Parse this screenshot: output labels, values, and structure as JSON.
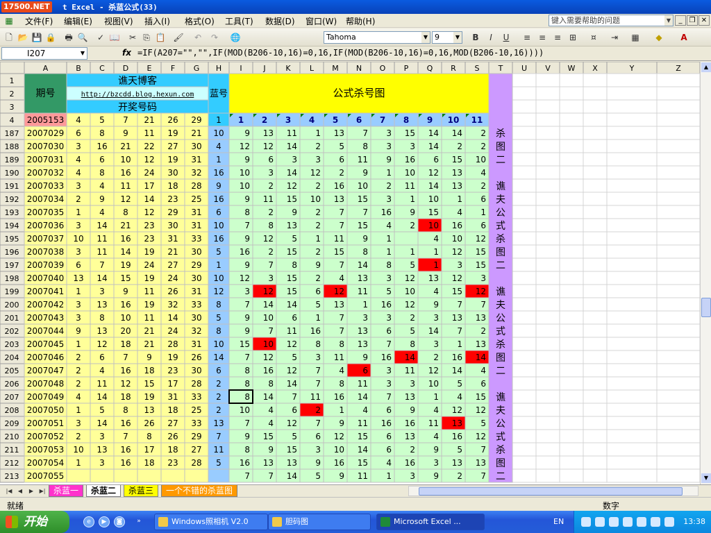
{
  "titlebar": {
    "logo": "17500.NET",
    "title": "t Excel - 杀蓝公式(33)"
  },
  "menu": {
    "items": [
      "文件(F)",
      "编辑(E)",
      "视图(V)",
      "插入(I)",
      "格式(O)",
      "工具(T)",
      "数据(D)",
      "窗口(W)",
      "帮助(H)"
    ],
    "help_placeholder": "键入需要帮助的问题"
  },
  "toolbar": {
    "font_name": "Tahoma",
    "font_size": "9",
    "bold": "B",
    "italic": "I",
    "underline": "U"
  },
  "formula_bar": {
    "name_box": "I207",
    "fx": "fx",
    "formula": "=IF(A207=\"\",\"\",IF(MOD(B206-10,16)=0,16,IF(MOD(B206-10,16)=0,16,MOD(B206-10,16))))"
  },
  "sheet": {
    "columns": [
      "A",
      "B",
      "C",
      "D",
      "E",
      "F",
      "G",
      "H",
      "I",
      "J",
      "K",
      "L",
      "M",
      "N",
      "O",
      "P",
      "Q",
      "R",
      "S",
      "T",
      "U",
      "V",
      "W",
      "X",
      "Y",
      "Z"
    ],
    "header": {
      "period_label": "期号",
      "blog_title": "谯天博客",
      "blog_url": "http://bzcdd.blog.hexun.com",
      "draw_label": "开奖号码",
      "blue_label": "蓝号",
      "chart_title": "公式杀号图",
      "row4_period": "2005153",
      "row4_numbers": [
        "4",
        "5",
        "7",
        "21",
        "26",
        "29"
      ],
      "row4_blue": "1",
      "formula_numbers": [
        "1",
        "2",
        "3",
        "4",
        "5",
        "6",
        "7",
        "8",
        "9",
        "10",
        "11"
      ]
    },
    "row_numbers": [
      "1",
      "2",
      "3",
      "4"
    ],
    "rows": [
      {
        "row": "187",
        "period": "2007029",
        "reds": [
          "6",
          "8",
          "9",
          "11",
          "19",
          "21"
        ],
        "blue": "10",
        "kills": [
          "9",
          "13",
          "11",
          "1",
          "13",
          "7",
          "3",
          "15",
          "14",
          "14",
          "2"
        ],
        "hits": []
      },
      {
        "row": "188",
        "period": "2007030",
        "reds": [
          "3",
          "16",
          "21",
          "22",
          "27",
          "30"
        ],
        "blue": "4",
        "kills": [
          "12",
          "12",
          "14",
          "2",
          "5",
          "8",
          "3",
          "3",
          "14",
          "2",
          "2"
        ],
        "hits": []
      },
      {
        "row": "189",
        "period": "2007031",
        "reds": [
          "4",
          "6",
          "10",
          "12",
          "19",
          "31"
        ],
        "blue": "1",
        "kills": [
          "9",
          "6",
          "3",
          "3",
          "6",
          "11",
          "9",
          "16",
          "6",
          "15",
          "10"
        ],
        "hits": []
      },
      {
        "row": "190",
        "period": "2007032",
        "reds": [
          "4",
          "8",
          "16",
          "24",
          "30",
          "32"
        ],
        "blue": "16",
        "kills": [
          "10",
          "3",
          "14",
          "12",
          "2",
          "9",
          "1",
          "10",
          "12",
          "13",
          "4"
        ],
        "hits": []
      },
      {
        "row": "191",
        "period": "2007033",
        "reds": [
          "3",
          "4",
          "11",
          "17",
          "18",
          "28"
        ],
        "blue": "9",
        "kills": [
          "10",
          "2",
          "12",
          "2",
          "16",
          "10",
          "2",
          "11",
          "14",
          "13",
          "2"
        ],
        "hits": []
      },
      {
        "row": "192",
        "period": "2007034",
        "reds": [
          "2",
          "9",
          "12",
          "14",
          "23",
          "25"
        ],
        "blue": "16",
        "kills": [
          "9",
          "11",
          "15",
          "10",
          "13",
          "15",
          "3",
          "1",
          "10",
          "1",
          "6"
        ],
        "hits": []
      },
      {
        "row": "193",
        "period": "2007035",
        "reds": [
          "1",
          "4",
          "8",
          "12",
          "29",
          "31"
        ],
        "blue": "6",
        "kills": [
          "8",
          "2",
          "9",
          "2",
          "7",
          "7",
          "16",
          "9",
          "15",
          "4",
          "1"
        ],
        "hits": []
      },
      {
        "row": "194",
        "period": "2007036",
        "reds": [
          "3",
          "14",
          "21",
          "23",
          "30",
          "31"
        ],
        "blue": "10",
        "kills": [
          "7",
          "8",
          "13",
          "2",
          "7",
          "15",
          "4",
          "2",
          "10",
          "16",
          "6"
        ],
        "hits": [
          8
        ]
      },
      {
        "row": "195",
        "period": "2007037",
        "reds": [
          "10",
          "11",
          "16",
          "23",
          "31",
          "33"
        ],
        "blue": "16",
        "kills": [
          "9",
          "12",
          "5",
          "1",
          "11",
          "9",
          "1",
          "",
          "4",
          "10",
          "12"
        ],
        "hits": []
      },
      {
        "row": "196",
        "period": "2007038",
        "reds": [
          "3",
          "11",
          "14",
          "19",
          "21",
          "30"
        ],
        "blue": "5",
        "kills": [
          "16",
          "2",
          "15",
          "2",
          "15",
          "8",
          "1",
          "1",
          "1",
          "12",
          "15"
        ],
        "hits": []
      },
      {
        "row": "197",
        "period": "2007039",
        "reds": [
          "6",
          "7",
          "19",
          "24",
          "27",
          "29"
        ],
        "blue": "1",
        "kills": [
          "9",
          "7",
          "8",
          "9",
          "7",
          "14",
          "8",
          "5",
          "1",
          "3",
          "15"
        ],
        "hits": [
          8
        ]
      },
      {
        "row": "198",
        "period": "2007040",
        "reds": [
          "13",
          "14",
          "15",
          "19",
          "24",
          "30"
        ],
        "blue": "10",
        "kills": [
          "12",
          "3",
          "15",
          "2",
          "4",
          "13",
          "3",
          "12",
          "13",
          "12",
          "3"
        ],
        "hits": []
      },
      {
        "row": "199",
        "period": "2007041",
        "reds": [
          "1",
          "3",
          "9",
          "11",
          "26",
          "31"
        ],
        "blue": "12",
        "kills": [
          "3",
          "12",
          "15",
          "6",
          "12",
          "11",
          "5",
          "10",
          "4",
          "15",
          "12"
        ],
        "hits": [
          1,
          4,
          10
        ]
      },
      {
        "row": "200",
        "period": "2007042",
        "reds": [
          "3",
          "13",
          "16",
          "19",
          "32",
          "33"
        ],
        "blue": "8",
        "kills": [
          "7",
          "14",
          "14",
          "5",
          "13",
          "1",
          "16",
          "12",
          "9",
          "7",
          "7"
        ],
        "hits": []
      },
      {
        "row": "201",
        "period": "2007043",
        "reds": [
          "3",
          "8",
          "10",
          "11",
          "14",
          "30"
        ],
        "blue": "5",
        "kills": [
          "9",
          "10",
          "6",
          "1",
          "7",
          "3",
          "3",
          "2",
          "3",
          "13",
          "13"
        ],
        "hits": []
      },
      {
        "row": "202",
        "period": "2007044",
        "reds": [
          "9",
          "13",
          "20",
          "21",
          "24",
          "32"
        ],
        "blue": "8",
        "kills": [
          "9",
          "7",
          "11",
          "16",
          "7",
          "13",
          "6",
          "5",
          "14",
          "7",
          "2"
        ],
        "hits": []
      },
      {
        "row": "203",
        "period": "2007045",
        "reds": [
          "1",
          "12",
          "18",
          "21",
          "28",
          "31"
        ],
        "blue": "10",
        "kills": [
          "15",
          "10",
          "12",
          "8",
          "8",
          "13",
          "7",
          "8",
          "3",
          "1",
          "13"
        ],
        "hits": [
          1
        ]
      },
      {
        "row": "204",
        "period": "2007046",
        "reds": [
          "2",
          "6",
          "7",
          "9",
          "19",
          "26"
        ],
        "blue": "14",
        "kills": [
          "7",
          "12",
          "5",
          "3",
          "11",
          "9",
          "16",
          "14",
          "2",
          "16",
          "14"
        ],
        "hits": [
          7,
          10
        ]
      },
      {
        "row": "205",
        "period": "2007047",
        "reds": [
          "2",
          "4",
          "16",
          "18",
          "23",
          "30"
        ],
        "blue": "6",
        "kills": [
          "8",
          "16",
          "12",
          "7",
          "4",
          "6",
          "3",
          "11",
          "12",
          "14",
          "4"
        ],
        "hits": [
          5
        ]
      },
      {
        "row": "206",
        "period": "2007048",
        "reds": [
          "2",
          "11",
          "12",
          "15",
          "17",
          "28"
        ],
        "blue": "2",
        "kills": [
          "8",
          "8",
          "14",
          "7",
          "8",
          "11",
          "3",
          "3",
          "10",
          "5",
          "6"
        ],
        "hits": []
      },
      {
        "row": "207",
        "period": "2007049",
        "reds": [
          "4",
          "14",
          "18",
          "19",
          "31",
          "33"
        ],
        "blue": "2",
        "kills": [
          "8",
          "14",
          "7",
          "11",
          "16",
          "14",
          "7",
          "13",
          "1",
          "4",
          "15"
        ],
        "hits": []
      },
      {
        "row": "208",
        "period": "2007050",
        "reds": [
          "1",
          "5",
          "8",
          "13",
          "18",
          "25"
        ],
        "blue": "2",
        "kills": [
          "10",
          "4",
          "6",
          "2",
          "1",
          "4",
          "6",
          "9",
          "4",
          "12",
          "12"
        ],
        "hits": [
          3
        ]
      },
      {
        "row": "209",
        "period": "2007051",
        "reds": [
          "3",
          "14",
          "16",
          "26",
          "27",
          "33"
        ],
        "blue": "13",
        "kills": [
          "7",
          "4",
          "12",
          "7",
          "9",
          "11",
          "16",
          "16",
          "11",
          "13",
          "5"
        ],
        "hits": [
          9
        ]
      },
      {
        "row": "210",
        "period": "2007052",
        "reds": [
          "2",
          "3",
          "7",
          "8",
          "26",
          "29"
        ],
        "blue": "7",
        "kills": [
          "9",
          "15",
          "5",
          "6",
          "12",
          "15",
          "6",
          "13",
          "4",
          "16",
          "12"
        ],
        "hits": []
      },
      {
        "row": "211",
        "period": "2007053",
        "reds": [
          "10",
          "13",
          "16",
          "17",
          "18",
          "27"
        ],
        "blue": "11",
        "kills": [
          "8",
          "9",
          "15",
          "3",
          "10",
          "14",
          "6",
          "2",
          "9",
          "5",
          "7"
        ],
        "hits": []
      },
      {
        "row": "212",
        "period": "2007054",
        "reds": [
          "1",
          "3",
          "16",
          "18",
          "23",
          "28"
        ],
        "blue": "5",
        "kills": [
          "16",
          "13",
          "13",
          "9",
          "16",
          "15",
          "4",
          "16",
          "3",
          "13",
          "13"
        ],
        "hits": []
      },
      {
        "row": "213",
        "period": "2007055",
        "reds": [
          "",
          "",
          "",
          "",
          "",
          ""
        ],
        "blue": "",
        "kills": [
          "7",
          "7",
          "14",
          "5",
          "9",
          "11",
          "1",
          "3",
          "9",
          "2",
          "7"
        ],
        "hits": []
      }
    ],
    "side_text": [
      "杀",
      "图",
      "二",
      "",
      "谯",
      "夫",
      "公",
      "式",
      "杀",
      "图",
      "二",
      "",
      "谯",
      "夫",
      "公",
      "式",
      "杀",
      "图",
      "二",
      "",
      "谯",
      "夫",
      "公",
      "式",
      "杀",
      "图",
      "二"
    ]
  },
  "sheet_tabs": [
    "杀蓝一",
    "杀蓝二",
    "杀蓝三",
    "一个不错的杀蓝图"
  ],
  "status": {
    "ready": "就绪",
    "mode": "数字"
  },
  "taskbar": {
    "start": "开始",
    "tasks": [
      "Windows照相机 V2.0",
      "胆码图",
      "Microsoft Excel ..."
    ],
    "lang": "EN",
    "clock": "13:38"
  },
  "colors": {
    "period_yellow": "#ffff99",
    "blue_col": "#99ccff",
    "header_cyan": "#33ccff",
    "kill_green": "#ccffcc",
    "hit_red": "#ff0000",
    "side_purple": "#cc99ff",
    "chart_yellow": "#ffff00",
    "period_header_green": "#339966"
  }
}
